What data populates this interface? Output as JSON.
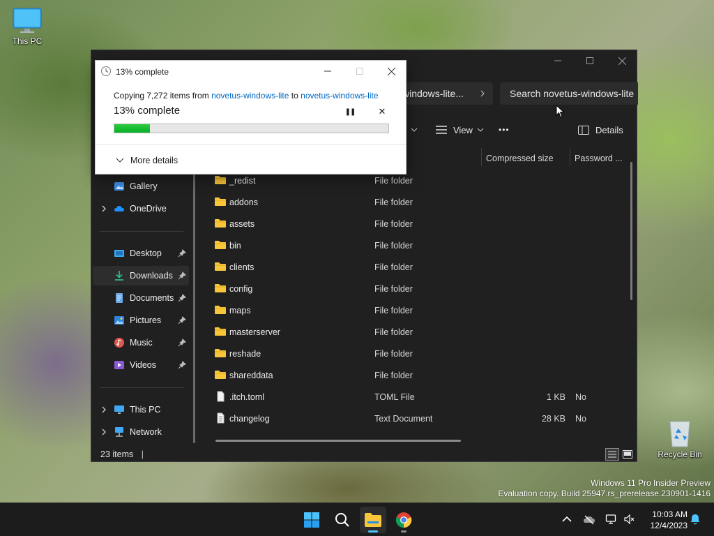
{
  "desktop": {
    "this_pc_label": "This PC",
    "recycle_bin_label": "Recycle Bin"
  },
  "explorer": {
    "address_segment": "...windows-lite",
    "search_placeholder": "Search novetus-windows-lite",
    "toolbar": {
      "view_label": "View",
      "more_label": "•••",
      "details_label": "Details"
    },
    "columns": {
      "compressed_size": "Compressed size",
      "password": "Password ..."
    },
    "sidebar": [
      {
        "label": "Gallery",
        "icon": "gallery-icon",
        "expandable": false,
        "pinned": false
      },
      {
        "label": "OneDrive",
        "icon": "cloud-icon",
        "expandable": true,
        "pinned": false
      },
      {
        "label": "Desktop",
        "icon": "desktop-icon",
        "expandable": false,
        "pinned": true
      },
      {
        "label": "Downloads",
        "icon": "download-icon",
        "expandable": false,
        "pinned": true,
        "active": true
      },
      {
        "label": "Documents",
        "icon": "document-icon",
        "expandable": false,
        "pinned": true
      },
      {
        "label": "Pictures",
        "icon": "pictures-icon",
        "expandable": false,
        "pinned": true
      },
      {
        "label": "Music",
        "icon": "music-icon",
        "expandable": false,
        "pinned": true
      },
      {
        "label": "Videos",
        "icon": "video-icon",
        "expandable": false,
        "pinned": true
      },
      {
        "label": "This PC",
        "icon": "pc-icon",
        "expandable": true,
        "pinned": false
      },
      {
        "label": "Network",
        "icon": "network-icon",
        "expandable": true,
        "pinned": false
      }
    ],
    "files": [
      {
        "name": "_redist",
        "type": "File folder",
        "size": "",
        "password": "",
        "kind": "folder"
      },
      {
        "name": "addons",
        "type": "File folder",
        "size": "",
        "password": "",
        "kind": "folder"
      },
      {
        "name": "assets",
        "type": "File folder",
        "size": "",
        "password": "",
        "kind": "folder"
      },
      {
        "name": "bin",
        "type": "File folder",
        "size": "",
        "password": "",
        "kind": "folder"
      },
      {
        "name": "clients",
        "type": "File folder",
        "size": "",
        "password": "",
        "kind": "folder"
      },
      {
        "name": "config",
        "type": "File folder",
        "size": "",
        "password": "",
        "kind": "folder"
      },
      {
        "name": "maps",
        "type": "File folder",
        "size": "",
        "password": "",
        "kind": "folder"
      },
      {
        "name": "masterserver",
        "type": "File folder",
        "size": "",
        "password": "",
        "kind": "folder"
      },
      {
        "name": "reshade",
        "type": "File folder",
        "size": "",
        "password": "",
        "kind": "folder"
      },
      {
        "name": "shareddata",
        "type": "File folder",
        "size": "",
        "password": "",
        "kind": "folder"
      },
      {
        "name": ".itch.toml",
        "type": "TOML File",
        "size": "1 KB",
        "password": "No",
        "kind": "file"
      },
      {
        "name": "changelog",
        "type": "Text Document",
        "size": "28 KB",
        "password": "No",
        "kind": "textfile"
      }
    ],
    "status_text": "23 items"
  },
  "copy_dialog": {
    "title": "13% complete",
    "line_prefix": "Copying 7,272 items from ",
    "source": "novetus-windows-lite",
    "line_mid": " to ",
    "destination": "novetus-windows-lite",
    "percent_text": "13% complete",
    "progress": 0.13,
    "more_details": "More details",
    "pause_glyph": "❚❚",
    "close_glyph": "✕"
  },
  "taskbar": {
    "time": "10:03 AM",
    "date": "12/4/2023"
  },
  "watermark": {
    "line1": "Windows 11 Pro Insider Preview",
    "line2": "Evaluation copy. Build 25947.rs_prerelease.230901-1416"
  },
  "colors": {
    "accent": "#0067c0",
    "progress": "#06b025",
    "folder": "#f8c63a"
  }
}
